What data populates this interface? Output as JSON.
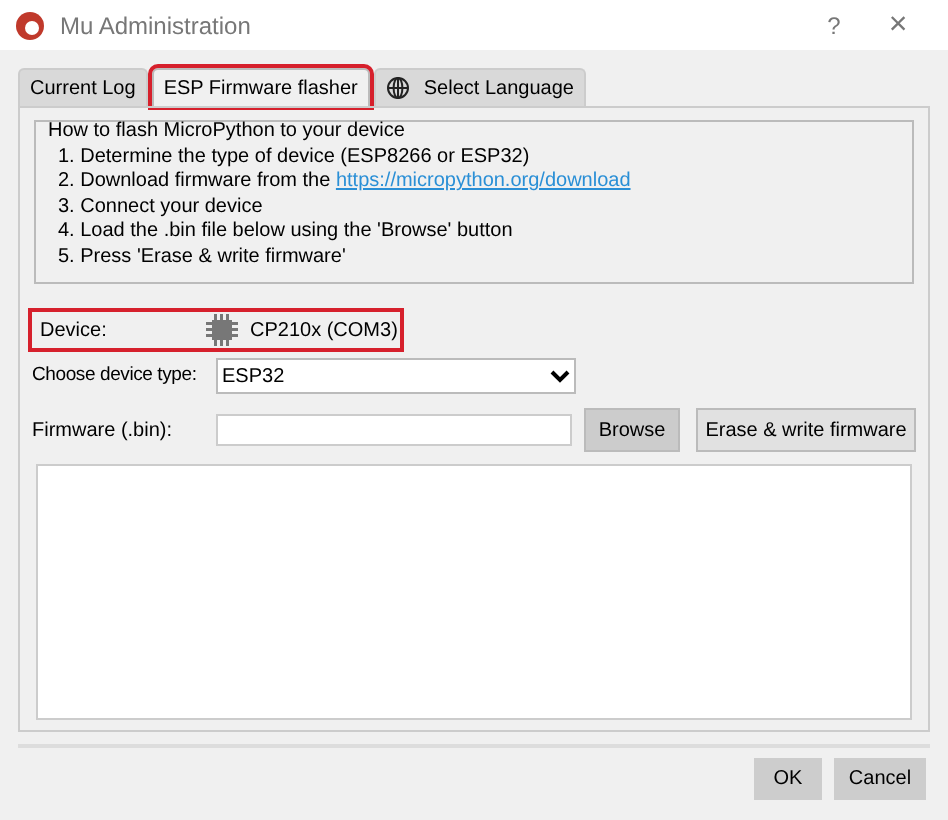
{
  "window": {
    "title": "Mu Administration",
    "help": "?",
    "close": "×"
  },
  "tabs": [
    {
      "label": "Current Log",
      "selected": false,
      "highlighted": false,
      "icon": false
    },
    {
      "label": "ESP Firmware flasher",
      "selected": true,
      "highlighted": true,
      "icon": false
    },
    {
      "label": "Select Language",
      "selected": false,
      "highlighted": false,
      "icon": true
    }
  ],
  "instructions": {
    "title": "How to flash MicroPython to your device",
    "steps": [
      {
        "kind": "text",
        "text": "1. Determine the type of device (ESP8266 or ESP32)"
      },
      {
        "kind": "link",
        "text": "2. Download firmware from the ",
        "link": "https://micropython.org/download"
      },
      {
        "kind": "text",
        "text": "3. Connect your device"
      },
      {
        "kind": "text",
        "text": "4. Load the .bin file below using the 'Browse' button"
      },
      {
        "kind": "text",
        "text": "5. Press 'Erase & write firmware'"
      }
    ]
  },
  "device": {
    "label": "Device:",
    "value": "CP210x (COM3)",
    "highlighted": true
  },
  "device_type": {
    "label": "Choose device type:",
    "value": "ESP32"
  },
  "firmware": {
    "label": "Firmware (.bin):",
    "browse": "Browse",
    "erase": "Erase & write firmware"
  },
  "buttons": [
    "OK",
    "Cancel"
  ]
}
